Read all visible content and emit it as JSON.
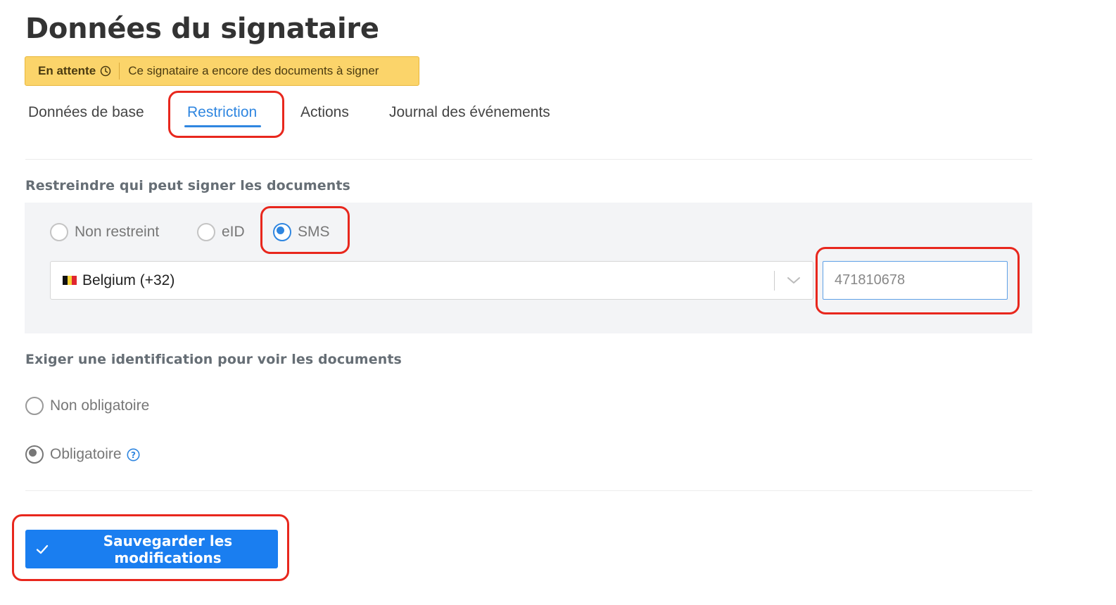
{
  "page": {
    "title": "Données du signataire"
  },
  "status": {
    "badge_label": "En attente",
    "message": "Ce signataire a encore des documents à signer",
    "icon": "clock-icon",
    "color": "#fbd46a"
  },
  "tabs": [
    {
      "label": "Données de base",
      "active": false
    },
    {
      "label": "Restriction",
      "active": true
    },
    {
      "label": "Actions",
      "active": false
    },
    {
      "label": "Journal des événements",
      "active": false
    }
  ],
  "restriction": {
    "heading": "Restreindre qui peut signer les documents",
    "options": [
      {
        "label": "Non restreint",
        "selected": false
      },
      {
        "label": "eID",
        "selected": false
      },
      {
        "label": "SMS",
        "selected": true
      }
    ],
    "country": {
      "value": "Belgium (+32)",
      "flag": "belgium-flag-icon",
      "icon": "chevron-down-icon"
    },
    "phone": {
      "value": "471810678"
    }
  },
  "identification": {
    "heading": "Exiger une identification pour voir les documents",
    "options": [
      {
        "label": "Non obligatoire",
        "selected": false
      },
      {
        "label": "Obligatoire",
        "selected": true,
        "icon": "help-icon"
      }
    ]
  },
  "actions": {
    "save_label": "Sauvegarder les modifications",
    "save_icon": "check-icon"
  },
  "colors": {
    "accent": "#2f86e0",
    "primary_button": "#1a7ef0",
    "annotation": "#e8271d"
  }
}
